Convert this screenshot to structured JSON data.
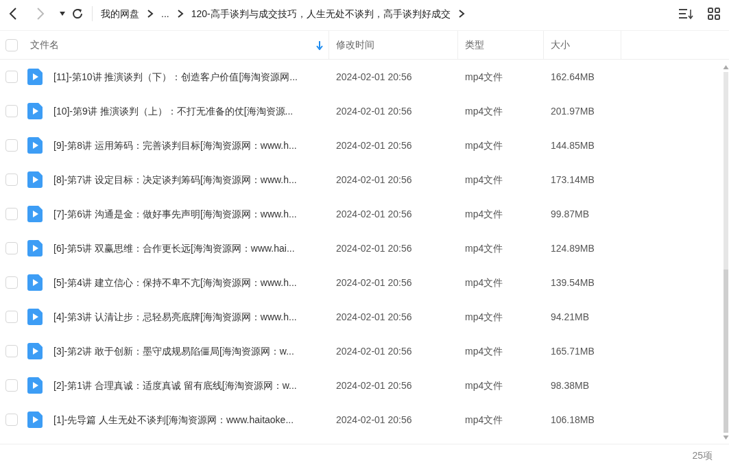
{
  "toolbar": {
    "back": {
      "disabled": false
    },
    "forward": {
      "disabled": true
    }
  },
  "breadcrumb": [
    "我的网盘",
    "...",
    "120-高手谈判与成交技巧，人生无处不谈判，高手谈判好成交"
  ],
  "table": {
    "select_all": {
      "checked": false
    },
    "columns": [
      {
        "label": "文件名",
        "sorted": true
      },
      {
        "label": "修改时间",
        "sorted": false
      },
      {
        "label": "类型",
        "sorted": false
      },
      {
        "label": "大小",
        "sorted": false
      }
    ],
    "rows": [
      {
        "checked": false,
        "name": "[11]-第10讲 推演谈判（下）：创造客户价值[海淘资源网...",
        "modified": "2024-02-01 20:56",
        "type": "mp4文件",
        "size": "162.64MB"
      },
      {
        "checked": false,
        "name": "[10]-第9讲 推演谈判（上）：不打无准备的仗[海淘资源...",
        "modified": "2024-02-01 20:56",
        "type": "mp4文件",
        "size": "201.97MB"
      },
      {
        "checked": false,
        "name": "[9]-第8讲 运用筹码：完善谈判目标[海淘资源网：www.h...",
        "modified": "2024-02-01 20:56",
        "type": "mp4文件",
        "size": "144.85MB"
      },
      {
        "checked": false,
        "name": "[8]-第7讲 设定目标：决定谈判筹码[海淘资源网：www.h...",
        "modified": "2024-02-01 20:56",
        "type": "mp4文件",
        "size": "173.14MB"
      },
      {
        "checked": false,
        "name": "[7]-第6讲 沟通是金：做好事先声明[海淘资源网：www.h...",
        "modified": "2024-02-01 20:56",
        "type": "mp4文件",
        "size": "99.87MB"
      },
      {
        "checked": false,
        "name": "[6]-第5讲 双赢思维：合作更长远[海淘资源网：www.hai...",
        "modified": "2024-02-01 20:56",
        "type": "mp4文件",
        "size": "124.89MB"
      },
      {
        "checked": false,
        "name": "[5]-第4讲 建立信心：保持不卑不亢[海淘资源网：www.h...",
        "modified": "2024-02-01 20:56",
        "type": "mp4文件",
        "size": "139.54MB"
      },
      {
        "checked": false,
        "name": "[4]-第3讲 认清让步：忌轻易亮底牌[海淘资源网：www.h...",
        "modified": "2024-02-01 20:56",
        "type": "mp4文件",
        "size": "94.21MB"
      },
      {
        "checked": false,
        "name": "[3]-第2讲 敢于创新：墨守成规易陷僵局[海淘资源网：w...",
        "modified": "2024-02-01 20:56",
        "type": "mp4文件",
        "size": "165.71MB"
      },
      {
        "checked": false,
        "name": "[2]-第1讲 合理真诚：适度真诚 留有底线[海淘资源网：w...",
        "modified": "2024-02-01 20:56",
        "type": "mp4文件",
        "size": "98.38MB"
      },
      {
        "checked": false,
        "name": "[1]-先导篇 人生无处不谈判[海淘资源网：www.haitaoke...",
        "modified": "2024-02-01 20:56",
        "type": "mp4文件",
        "size": "106.18MB"
      }
    ]
  },
  "status_bar": {
    "count": "25项"
  }
}
